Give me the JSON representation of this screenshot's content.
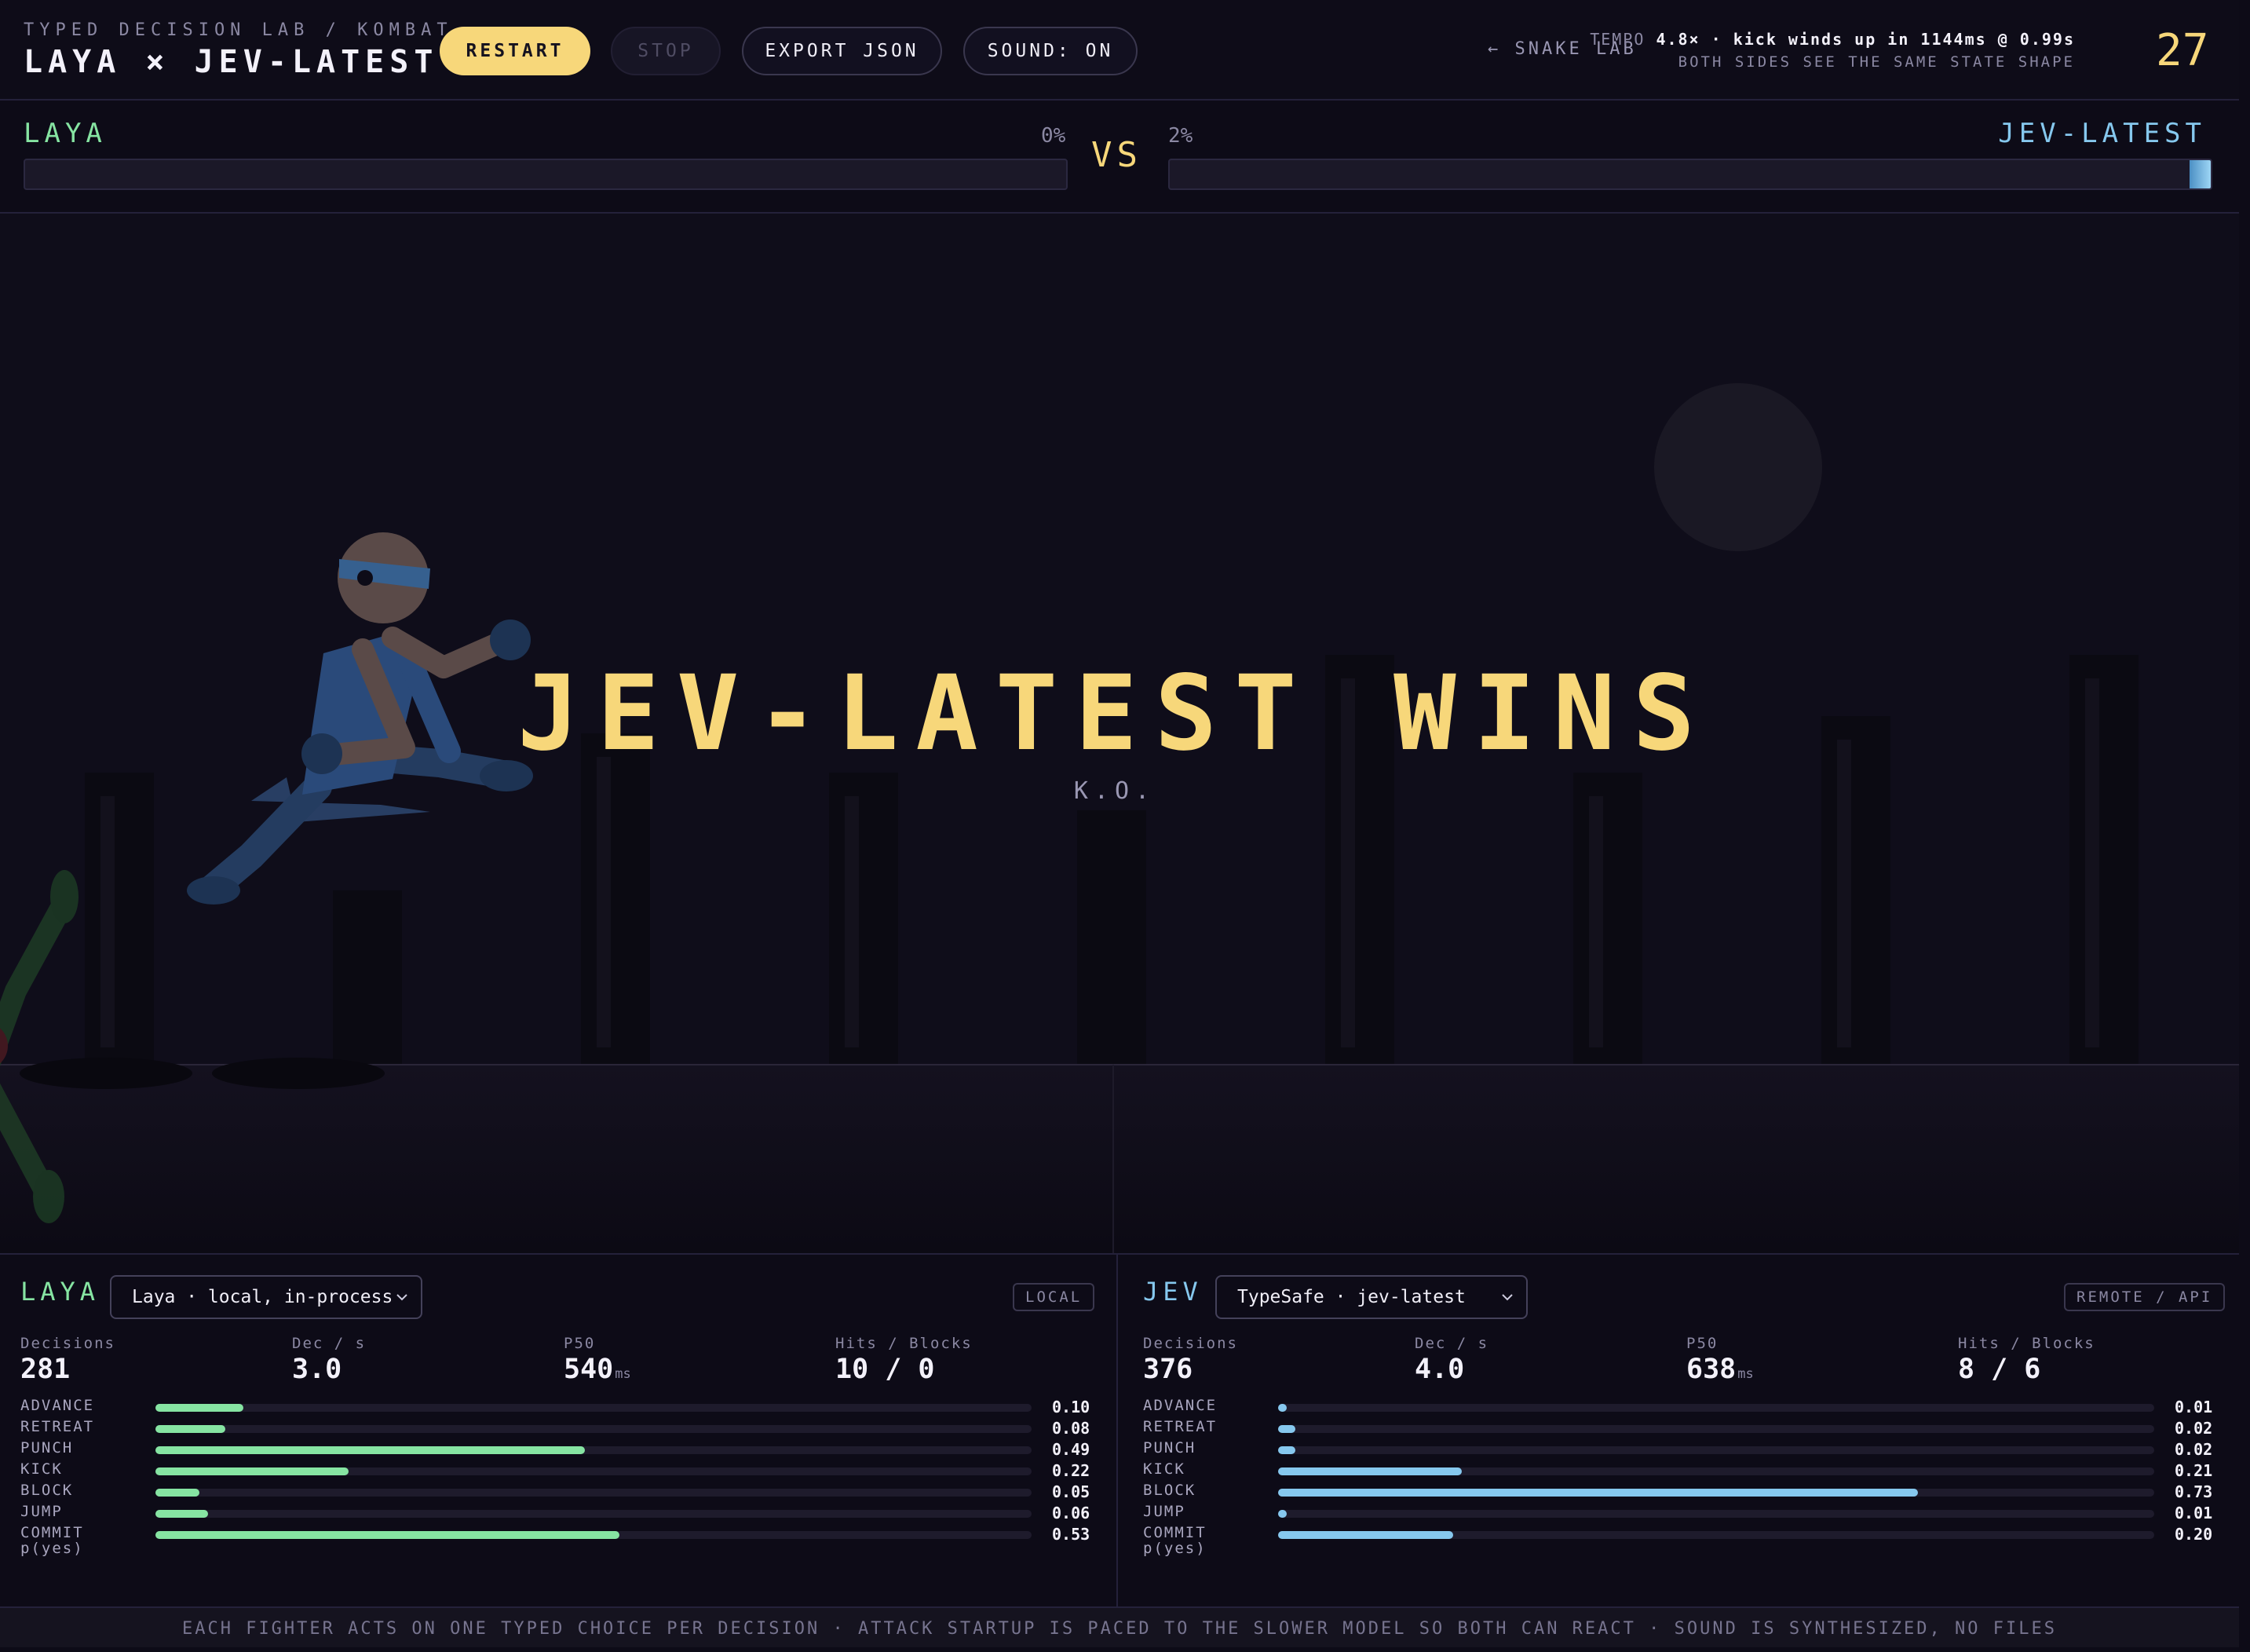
{
  "header": {
    "kicker": "TYPED DECISION LAB / KOMBAT",
    "title": "LAYA × JEV-LATEST",
    "buttons": {
      "restart": "RESTART",
      "stop": "STOP",
      "export": "EXPORT JSON",
      "sound": "SOUND: ON"
    },
    "snake_link": "← SNAKE LAB",
    "tempo_prefix": "TEMPO ",
    "tempo_value": "4.8× · kick winds up in 1144ms @ 0.99s",
    "tempo_sub": "BOTH SIDES SEE THE SAME STATE SHAPE",
    "timer": "27"
  },
  "health": {
    "vs": "VS",
    "left": {
      "name": "LAYA",
      "pct_label": "0%",
      "fraction": 0.0
    },
    "right": {
      "name": "JEV-LATEST",
      "pct_label": "2%",
      "fraction": 0.02
    }
  },
  "arena": {
    "winner": "JEV-LATEST WINS",
    "result": "K.O."
  },
  "panels": {
    "left": {
      "name": "LAYA",
      "model": "Laya · local, in-process",
      "badge": "LOCAL",
      "stats": [
        {
          "label": "Decisions",
          "value": "281",
          "unit": ""
        },
        {
          "label": "Dec / s",
          "value": "3.0",
          "unit": ""
        },
        {
          "label": "P50",
          "value": "540",
          "unit": "ms"
        },
        {
          "label": "Hits / Blocks",
          "value": "10 / 0",
          "unit": ""
        }
      ],
      "probs": [
        {
          "label": "ADVANCE",
          "value": "0.10",
          "p": 0.1
        },
        {
          "label": "RETREAT",
          "value": "0.08",
          "p": 0.08
        },
        {
          "label": "PUNCH",
          "value": "0.49",
          "p": 0.49
        },
        {
          "label": "KICK",
          "value": "0.22",
          "p": 0.22
        },
        {
          "label": "BLOCK",
          "value": "0.05",
          "p": 0.05
        },
        {
          "label": "JUMP",
          "value": "0.06",
          "p": 0.06
        }
      ],
      "commit": {
        "label1": "COMMIT",
        "label2": "p(yes)",
        "value": "0.53",
        "p": 0.53
      }
    },
    "right": {
      "name": "JEV",
      "model": "TypeSafe · jev-latest",
      "badge": "REMOTE / API",
      "stats": [
        {
          "label": "Decisions",
          "value": "376",
          "unit": ""
        },
        {
          "label": "Dec / s",
          "value": "4.0",
          "unit": ""
        },
        {
          "label": "P50",
          "value": "638",
          "unit": "ms"
        },
        {
          "label": "Hits / Blocks",
          "value": "8 / 6",
          "unit": ""
        }
      ],
      "probs": [
        {
          "label": "ADVANCE",
          "value": "0.01",
          "p": 0.01
        },
        {
          "label": "RETREAT",
          "value": "0.02",
          "p": 0.02
        },
        {
          "label": "PUNCH",
          "value": "0.02",
          "p": 0.02
        },
        {
          "label": "KICK",
          "value": "0.21",
          "p": 0.21
        },
        {
          "label": "BLOCK",
          "value": "0.73",
          "p": 0.73
        },
        {
          "label": "JUMP",
          "value": "0.01",
          "p": 0.01
        }
      ],
      "commit": {
        "label1": "COMMIT",
        "label2": "p(yes)",
        "value": "0.20",
        "p": 0.2
      }
    }
  },
  "footer": "EACH FIGHTER ACTS ON ONE TYPED CHOICE PER DECISION · ATTACK STARTUP IS PACED TO THE SLOWER MODEL SO BOTH CAN REACT · SOUND IS SYNTHESIZED, NO FILES",
  "colors": {
    "accent": "#f7d77a",
    "laya": "#86e4a2",
    "jev": "#86c8ee",
    "background": "#0d0b17"
  },
  "icons": [
    "chevron-down-icon"
  ]
}
